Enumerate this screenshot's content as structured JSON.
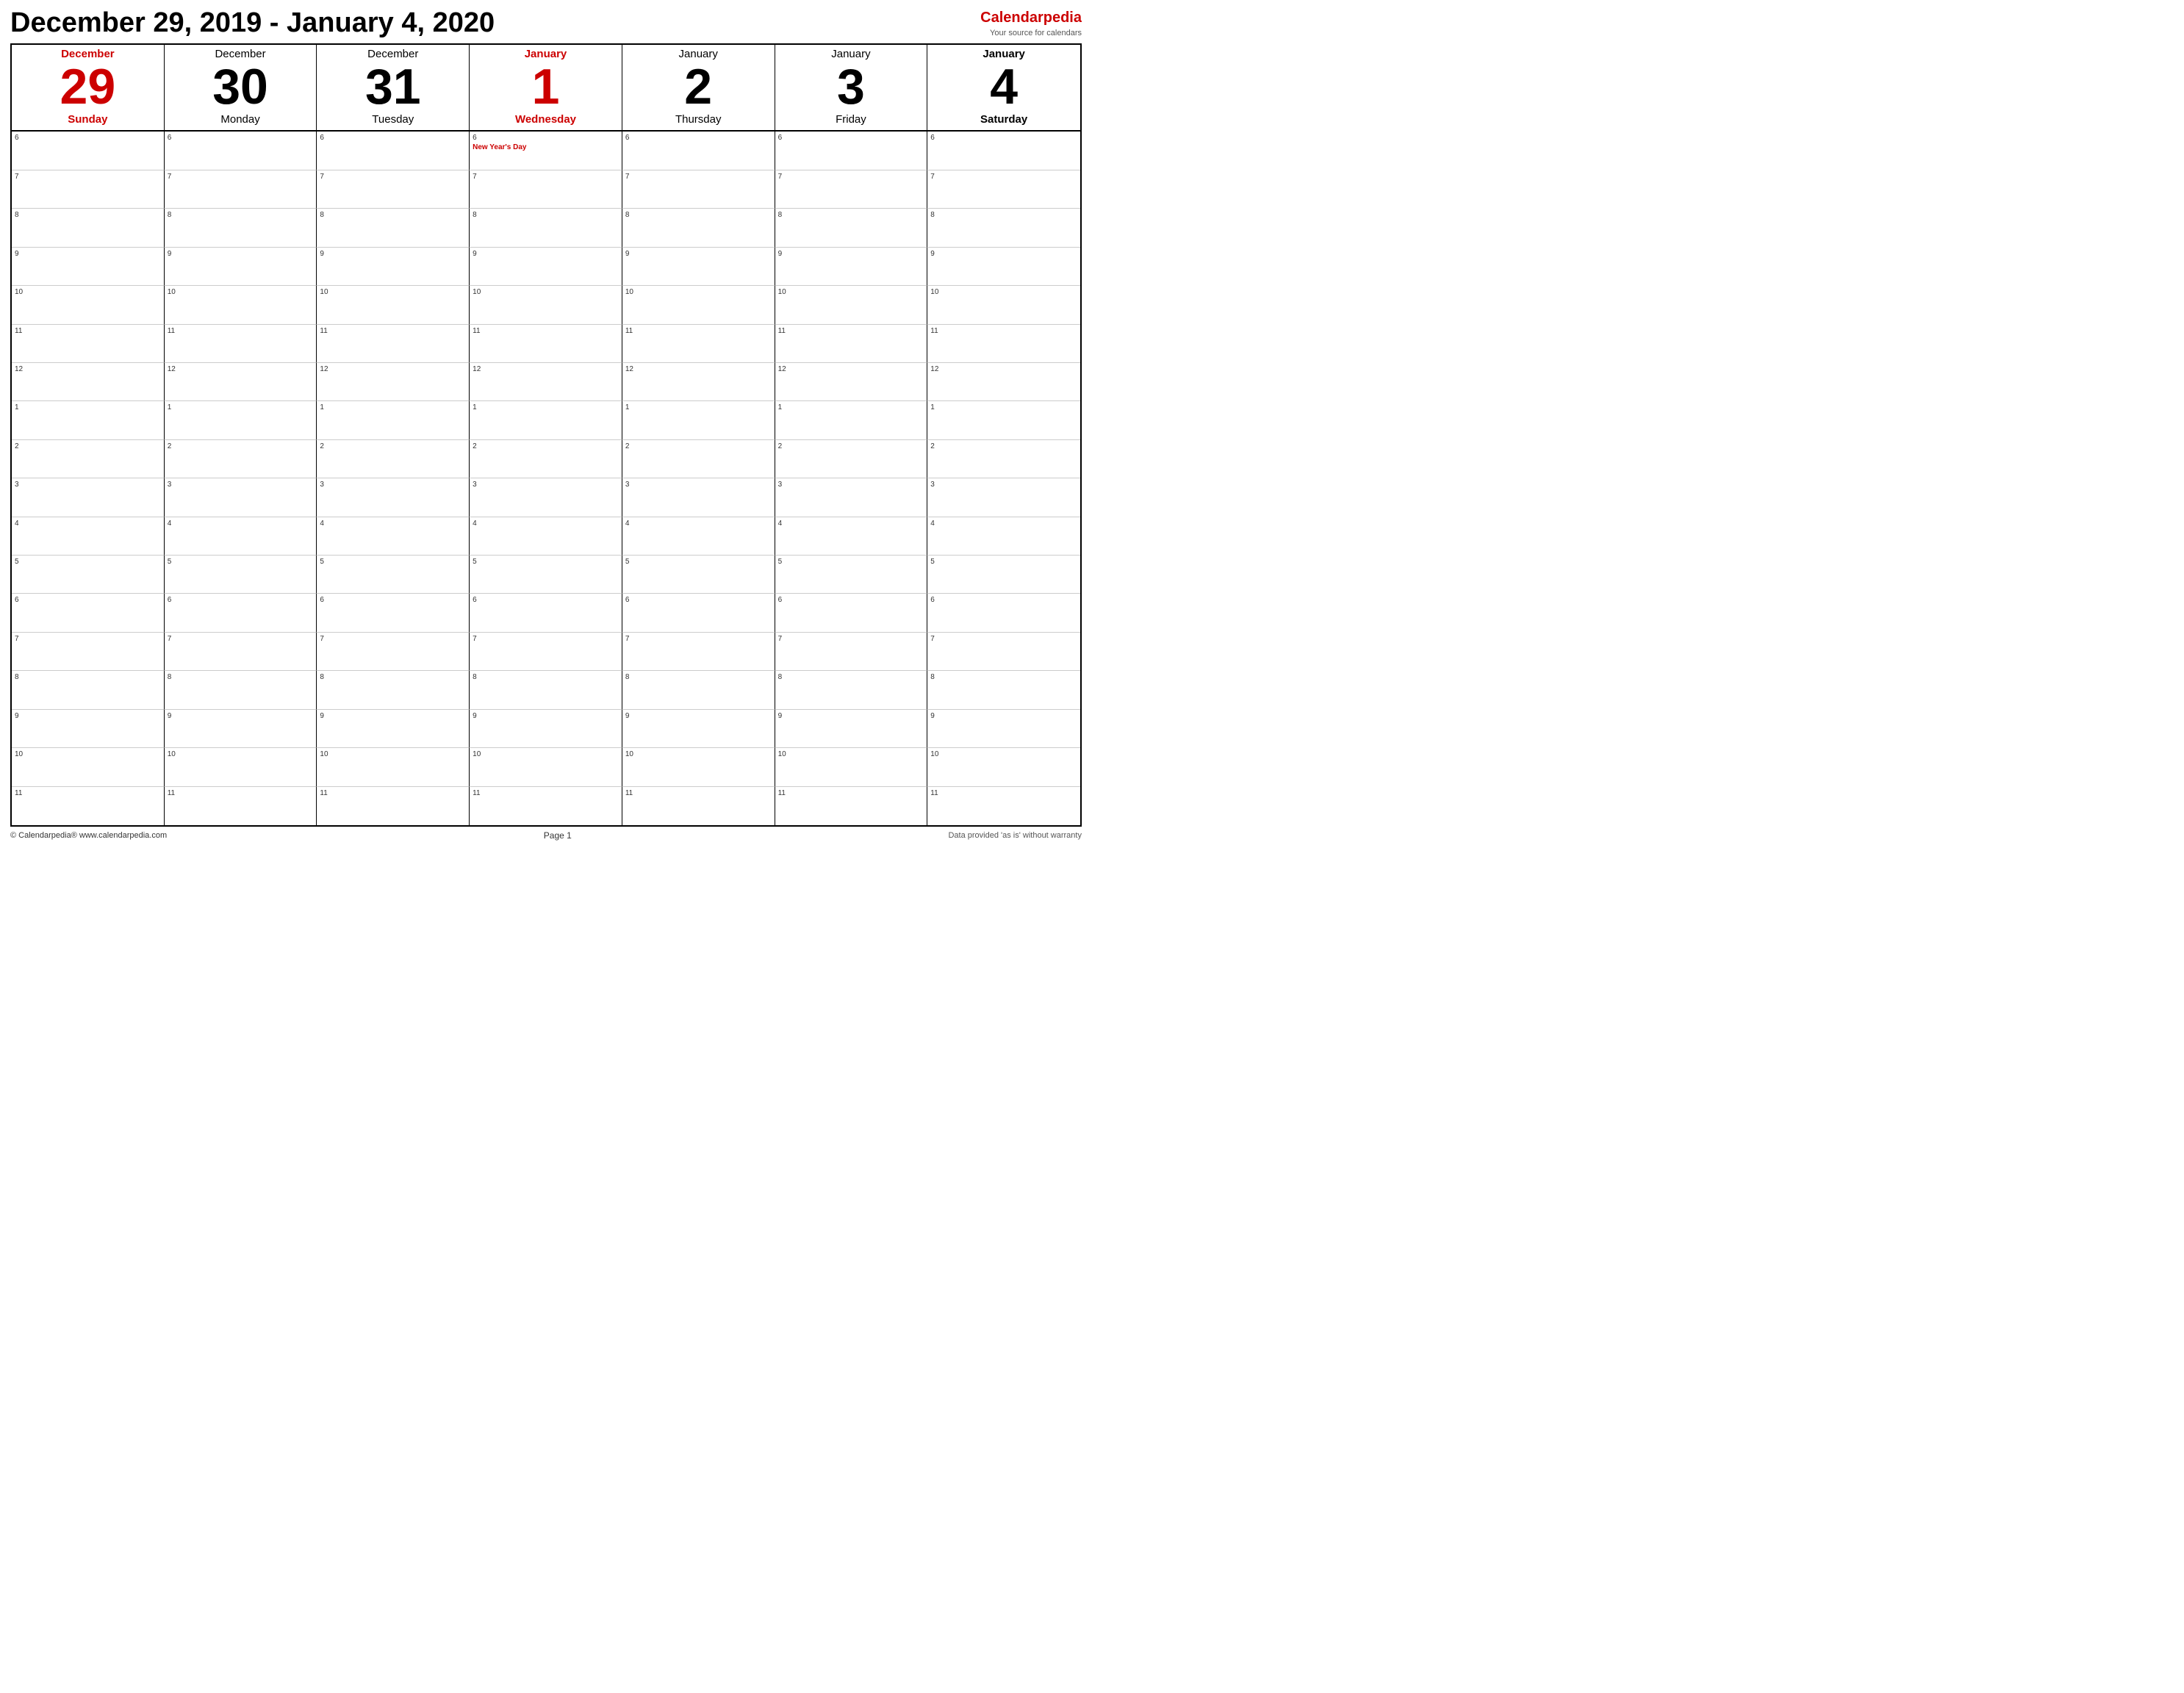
{
  "header": {
    "title": "December 29, 2019 - January 4, 2020"
  },
  "logo": {
    "name": "Calendar",
    "highlight": "pedia",
    "tagline": "Your source for calendars"
  },
  "days": [
    {
      "month": "December",
      "number": "29",
      "name": "Sunday",
      "highlight": "first",
      "today": false
    },
    {
      "month": "December",
      "number": "30",
      "name": "Monday",
      "highlight": "none",
      "today": false
    },
    {
      "month": "December",
      "number": "31",
      "name": "Tuesday",
      "highlight": "none",
      "today": false
    },
    {
      "month": "January",
      "number": "1",
      "name": "Wednesday",
      "highlight": "today",
      "today": true
    },
    {
      "month": "January",
      "number": "2",
      "name": "Thursday",
      "highlight": "none",
      "today": false
    },
    {
      "month": "January",
      "number": "3",
      "name": "Friday",
      "highlight": "none",
      "today": false
    },
    {
      "month": "January",
      "number": "4",
      "name": "Saturday",
      "highlight": "last",
      "today": false
    }
  ],
  "time_slots": [
    "6",
    "7",
    "8",
    "9",
    "10",
    "11",
    "12",
    "1",
    "2",
    "3",
    "4",
    "5",
    "6",
    "7",
    "8",
    "9",
    "10",
    "11"
  ],
  "events": {
    "jan1_6am": "New Year's Day"
  },
  "footer": {
    "left": "© Calendarpedia®   www.calendarpedia.com",
    "center": "Page 1",
    "right": "Data provided 'as is' without warranty"
  }
}
